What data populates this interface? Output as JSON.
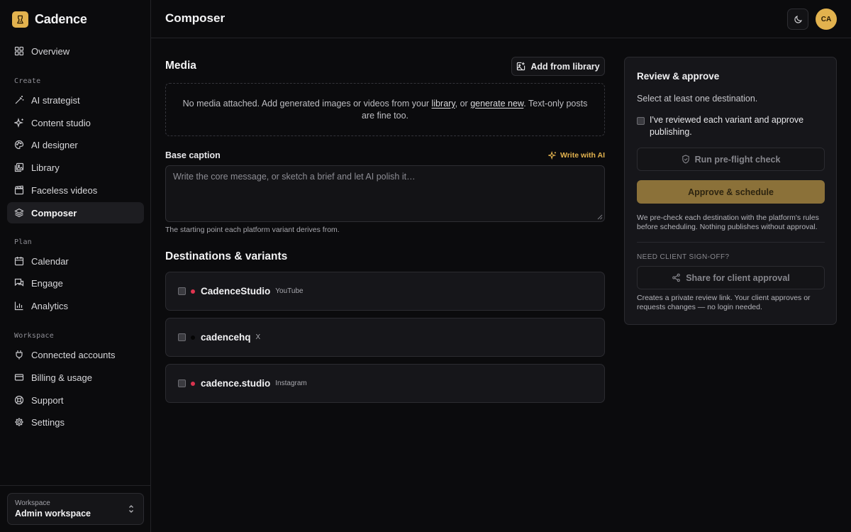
{
  "brand": {
    "name": "Cadence"
  },
  "sidebar": {
    "overview": "Overview",
    "sections": [
      {
        "label": "Create",
        "items": [
          "AI strategist",
          "Content studio",
          "AI designer",
          "Library",
          "Faceless videos",
          "Composer"
        ]
      },
      {
        "label": "Plan",
        "items": [
          "Calendar",
          "Engage",
          "Analytics"
        ]
      },
      {
        "label": "Workspace",
        "items": [
          "Connected accounts",
          "Billing & usage",
          "Support",
          "Settings"
        ]
      }
    ],
    "active_item": "Composer",
    "workspace": {
      "label": "Workspace",
      "value": "Admin workspace"
    }
  },
  "header": {
    "title": "Composer",
    "avatar_initials": "CA"
  },
  "media": {
    "title": "Media",
    "add_button": "Add from library",
    "empty_before": "No media attached. Add generated images or videos from your ",
    "empty_link1": "library",
    "empty_middle": ", or ",
    "empty_link2": "generate new",
    "empty_after": ". Text-only posts are fine too."
  },
  "caption": {
    "label": "Base caption",
    "ai_link": "Write with AI",
    "placeholder": "Write the core message, or sketch a brief and let AI polish it…",
    "hint": "The starting point each platform variant derives from."
  },
  "destinations": {
    "title": "Destinations & variants",
    "items": [
      {
        "name": "CadenceStudio",
        "platform": "YouTube",
        "dot_color": "#e0344f"
      },
      {
        "name": "cadencehq",
        "platform": "X",
        "dot_color": "#050505"
      },
      {
        "name": "cadence.studio",
        "platform": "Instagram",
        "dot_color": "#d9334f"
      }
    ]
  },
  "review": {
    "title": "Review & approve",
    "select_hint": "Select at least one destination.",
    "approve_checkbox": "I've reviewed each variant and approve publishing.",
    "preflight_button": "Run pre-flight check",
    "approve_button": "Approve & schedule",
    "precheck_note": "We pre-check each destination with the platform's rules before scheduling. Nothing publishes without approval.",
    "signoff_label": "NEED CLIENT SIGN-OFF?",
    "share_button": "Share for client approval",
    "share_note": "Creates a private review link. Your client approves or requests changes — no login needed."
  },
  "colors": {
    "accent": "#e2b24e",
    "background": "#0b0b0d",
    "card": "#16161a",
    "primary_button": "#8b7139"
  }
}
